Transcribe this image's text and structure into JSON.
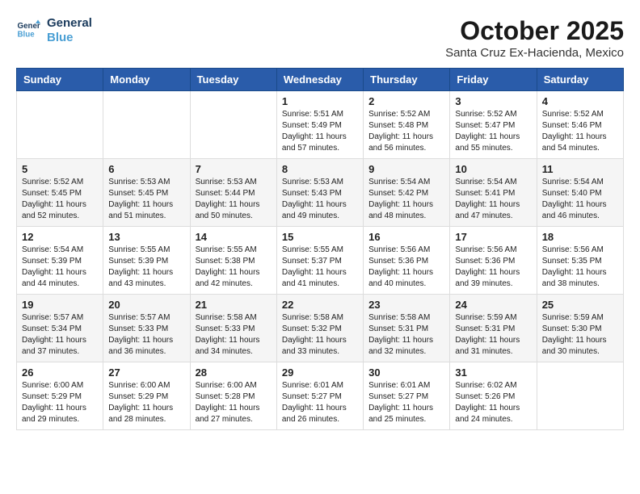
{
  "header": {
    "logo_line1": "General",
    "logo_line2": "Blue",
    "month": "October 2025",
    "location": "Santa Cruz Ex-Hacienda, Mexico"
  },
  "days_of_week": [
    "Sunday",
    "Monday",
    "Tuesday",
    "Wednesday",
    "Thursday",
    "Friday",
    "Saturday"
  ],
  "weeks": [
    [
      {
        "day": "",
        "info": ""
      },
      {
        "day": "",
        "info": ""
      },
      {
        "day": "",
        "info": ""
      },
      {
        "day": "1",
        "info": "Sunrise: 5:51 AM\nSunset: 5:49 PM\nDaylight: 11 hours\nand 57 minutes."
      },
      {
        "day": "2",
        "info": "Sunrise: 5:52 AM\nSunset: 5:48 PM\nDaylight: 11 hours\nand 56 minutes."
      },
      {
        "day": "3",
        "info": "Sunrise: 5:52 AM\nSunset: 5:47 PM\nDaylight: 11 hours\nand 55 minutes."
      },
      {
        "day": "4",
        "info": "Sunrise: 5:52 AM\nSunset: 5:46 PM\nDaylight: 11 hours\nand 54 minutes."
      }
    ],
    [
      {
        "day": "5",
        "info": "Sunrise: 5:52 AM\nSunset: 5:45 PM\nDaylight: 11 hours\nand 52 minutes."
      },
      {
        "day": "6",
        "info": "Sunrise: 5:53 AM\nSunset: 5:45 PM\nDaylight: 11 hours\nand 51 minutes."
      },
      {
        "day": "7",
        "info": "Sunrise: 5:53 AM\nSunset: 5:44 PM\nDaylight: 11 hours\nand 50 minutes."
      },
      {
        "day": "8",
        "info": "Sunrise: 5:53 AM\nSunset: 5:43 PM\nDaylight: 11 hours\nand 49 minutes."
      },
      {
        "day": "9",
        "info": "Sunrise: 5:54 AM\nSunset: 5:42 PM\nDaylight: 11 hours\nand 48 minutes."
      },
      {
        "day": "10",
        "info": "Sunrise: 5:54 AM\nSunset: 5:41 PM\nDaylight: 11 hours\nand 47 minutes."
      },
      {
        "day": "11",
        "info": "Sunrise: 5:54 AM\nSunset: 5:40 PM\nDaylight: 11 hours\nand 46 minutes."
      }
    ],
    [
      {
        "day": "12",
        "info": "Sunrise: 5:54 AM\nSunset: 5:39 PM\nDaylight: 11 hours\nand 44 minutes."
      },
      {
        "day": "13",
        "info": "Sunrise: 5:55 AM\nSunset: 5:39 PM\nDaylight: 11 hours\nand 43 minutes."
      },
      {
        "day": "14",
        "info": "Sunrise: 5:55 AM\nSunset: 5:38 PM\nDaylight: 11 hours\nand 42 minutes."
      },
      {
        "day": "15",
        "info": "Sunrise: 5:55 AM\nSunset: 5:37 PM\nDaylight: 11 hours\nand 41 minutes."
      },
      {
        "day": "16",
        "info": "Sunrise: 5:56 AM\nSunset: 5:36 PM\nDaylight: 11 hours\nand 40 minutes."
      },
      {
        "day": "17",
        "info": "Sunrise: 5:56 AM\nSunset: 5:36 PM\nDaylight: 11 hours\nand 39 minutes."
      },
      {
        "day": "18",
        "info": "Sunrise: 5:56 AM\nSunset: 5:35 PM\nDaylight: 11 hours\nand 38 minutes."
      }
    ],
    [
      {
        "day": "19",
        "info": "Sunrise: 5:57 AM\nSunset: 5:34 PM\nDaylight: 11 hours\nand 37 minutes."
      },
      {
        "day": "20",
        "info": "Sunrise: 5:57 AM\nSunset: 5:33 PM\nDaylight: 11 hours\nand 36 minutes."
      },
      {
        "day": "21",
        "info": "Sunrise: 5:58 AM\nSunset: 5:33 PM\nDaylight: 11 hours\nand 34 minutes."
      },
      {
        "day": "22",
        "info": "Sunrise: 5:58 AM\nSunset: 5:32 PM\nDaylight: 11 hours\nand 33 minutes."
      },
      {
        "day": "23",
        "info": "Sunrise: 5:58 AM\nSunset: 5:31 PM\nDaylight: 11 hours\nand 32 minutes."
      },
      {
        "day": "24",
        "info": "Sunrise: 5:59 AM\nSunset: 5:31 PM\nDaylight: 11 hours\nand 31 minutes."
      },
      {
        "day": "25",
        "info": "Sunrise: 5:59 AM\nSunset: 5:30 PM\nDaylight: 11 hours\nand 30 minutes."
      }
    ],
    [
      {
        "day": "26",
        "info": "Sunrise: 6:00 AM\nSunset: 5:29 PM\nDaylight: 11 hours\nand 29 minutes."
      },
      {
        "day": "27",
        "info": "Sunrise: 6:00 AM\nSunset: 5:29 PM\nDaylight: 11 hours\nand 28 minutes."
      },
      {
        "day": "28",
        "info": "Sunrise: 6:00 AM\nSunset: 5:28 PM\nDaylight: 11 hours\nand 27 minutes."
      },
      {
        "day": "29",
        "info": "Sunrise: 6:01 AM\nSunset: 5:27 PM\nDaylight: 11 hours\nand 26 minutes."
      },
      {
        "day": "30",
        "info": "Sunrise: 6:01 AM\nSunset: 5:27 PM\nDaylight: 11 hours\nand 25 minutes."
      },
      {
        "day": "31",
        "info": "Sunrise: 6:02 AM\nSunset: 5:26 PM\nDaylight: 11 hours\nand 24 minutes."
      },
      {
        "day": "",
        "info": ""
      }
    ]
  ]
}
